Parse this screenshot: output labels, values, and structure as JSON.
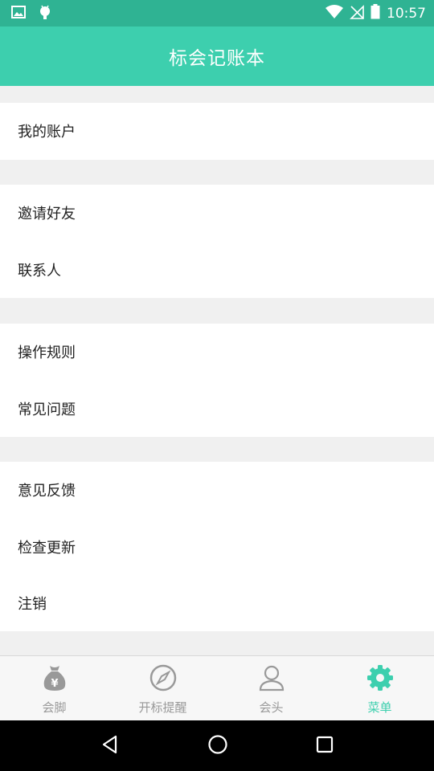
{
  "status_bar": {
    "time": "10:57",
    "icons": [
      "image-icon",
      "android-icon",
      "wifi-icon",
      "no-sim-icon",
      "battery-icon"
    ]
  },
  "app_bar": {
    "title": "标会记账本"
  },
  "menu": {
    "groups": [
      {
        "items": [
          {
            "label": "我的账户"
          }
        ]
      },
      {
        "items": [
          {
            "label": "邀请好友"
          },
          {
            "label": "联系人"
          }
        ]
      },
      {
        "items": [
          {
            "label": "操作规则"
          },
          {
            "label": "常见问题"
          }
        ]
      },
      {
        "items": [
          {
            "label": "意见反馈"
          },
          {
            "label": "检查更新"
          },
          {
            "label": "注销"
          }
        ]
      }
    ]
  },
  "tabs": [
    {
      "label": "会脚",
      "icon": "money-bag-icon",
      "active": false
    },
    {
      "label": "开标提醒",
      "icon": "compass-icon",
      "active": false
    },
    {
      "label": "会头",
      "icon": "person-icon",
      "active": false
    },
    {
      "label": "菜单",
      "icon": "gear-icon",
      "active": true
    }
  ],
  "colors": {
    "primary": "#3dcfae",
    "status_bar": "#2fb393",
    "inactive_tab": "#999999",
    "background": "#f0f0f0"
  },
  "nav": {
    "buttons": [
      "back-icon",
      "home-icon",
      "recents-icon"
    ]
  }
}
